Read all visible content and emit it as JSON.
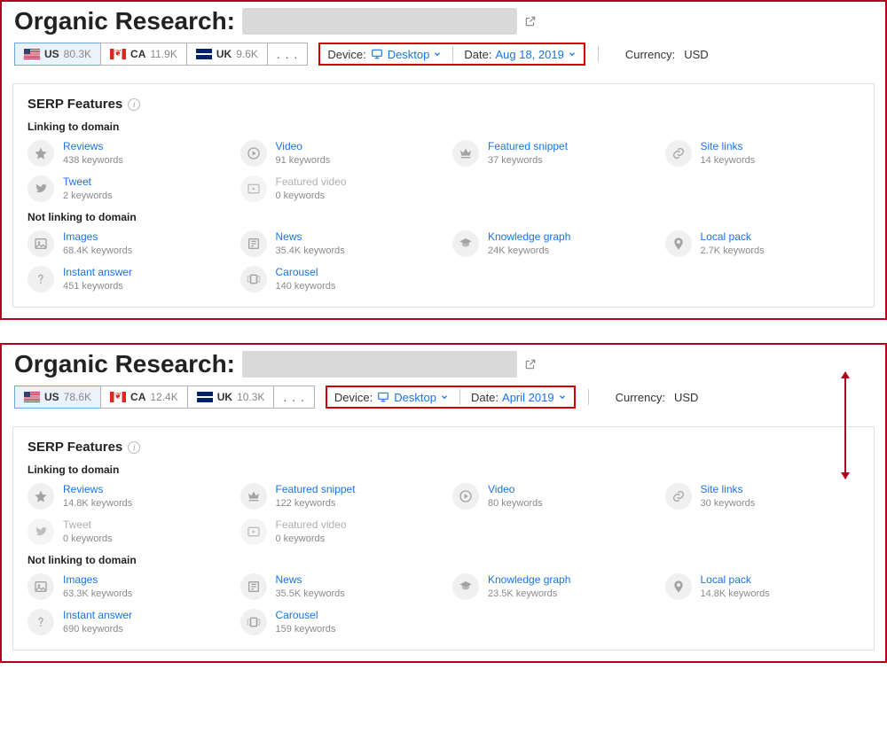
{
  "panels": [
    {
      "title": "Organic Research:",
      "countries": [
        {
          "code": "US",
          "count": "80.3K",
          "flag": "us",
          "active": true
        },
        {
          "code": "CA",
          "count": "11.9K",
          "flag": "ca",
          "active": false
        },
        {
          "code": "UK",
          "count": "9.6K",
          "flag": "uk",
          "active": false
        }
      ],
      "more": ". . .",
      "device_label": "Device:",
      "device_value": "Desktop",
      "date_label": "Date:",
      "date_value": "Aug 18, 2019",
      "currency_label": "Currency:",
      "currency_value": "USD",
      "serp_title": "SERP Features",
      "section_linking": "Linking to domain",
      "section_not_linking": "Not linking to domain",
      "linking": [
        {
          "name": "Reviews",
          "sub": "438 keywords",
          "icon": "star"
        },
        {
          "name": "Video",
          "sub": "91 keywords",
          "icon": "play"
        },
        {
          "name": "Featured snippet",
          "sub": "37 keywords",
          "icon": "crown"
        },
        {
          "name": "Site links",
          "sub": "14 keywords",
          "icon": "link"
        },
        {
          "name": "Tweet",
          "sub": "2 keywords",
          "icon": "twitter"
        },
        {
          "name": "Featured video",
          "sub": "0 keywords",
          "icon": "playbox",
          "disabled": true
        }
      ],
      "not_linking": [
        {
          "name": "Images",
          "sub": "68.4K keywords",
          "icon": "image"
        },
        {
          "name": "News",
          "sub": "35.4K keywords",
          "icon": "news"
        },
        {
          "name": "Knowledge graph",
          "sub": "24K keywords",
          "icon": "grad"
        },
        {
          "name": "Local pack",
          "sub": "2.7K keywords",
          "icon": "pin"
        },
        {
          "name": "Instant answer",
          "sub": "451 keywords",
          "icon": "question"
        },
        {
          "name": "Carousel",
          "sub": "140 keywords",
          "icon": "carousel"
        }
      ]
    },
    {
      "title": "Organic Research:",
      "countries": [
        {
          "code": "US",
          "count": "78.6K",
          "flag": "us",
          "active": true
        },
        {
          "code": "CA",
          "count": "12.4K",
          "flag": "ca",
          "active": false
        },
        {
          "code": "UK",
          "count": "10.3K",
          "flag": "uk",
          "active": false
        }
      ],
      "more": ". . .",
      "device_label": "Device:",
      "device_value": "Desktop",
      "date_label": "Date:",
      "date_value": "April 2019",
      "currency_label": "Currency:",
      "currency_value": "USD",
      "serp_title": "SERP Features",
      "section_linking": "Linking to domain",
      "section_not_linking": "Not linking to domain",
      "linking": [
        {
          "name": "Reviews",
          "sub": "14.8K keywords",
          "icon": "star"
        },
        {
          "name": "Featured snippet",
          "sub": "122 keywords",
          "icon": "crown"
        },
        {
          "name": "Video",
          "sub": "80 keywords",
          "icon": "play"
        },
        {
          "name": "Site links",
          "sub": "30 keywords",
          "icon": "link"
        },
        {
          "name": "Tweet",
          "sub": "0 keywords",
          "icon": "twitter",
          "disabled": true
        },
        {
          "name": "Featured video",
          "sub": "0 keywords",
          "icon": "playbox",
          "disabled": true
        }
      ],
      "not_linking": [
        {
          "name": "Images",
          "sub": "63.3K keywords",
          "icon": "image"
        },
        {
          "name": "News",
          "sub": "35.5K keywords",
          "icon": "news"
        },
        {
          "name": "Knowledge graph",
          "sub": "23.5K keywords",
          "icon": "grad"
        },
        {
          "name": "Local pack",
          "sub": "14.8K keywords",
          "icon": "pin"
        },
        {
          "name": "Instant answer",
          "sub": "690 keywords",
          "icon": "question"
        },
        {
          "name": "Carousel",
          "sub": "159 keywords",
          "icon": "carousel"
        }
      ]
    }
  ]
}
